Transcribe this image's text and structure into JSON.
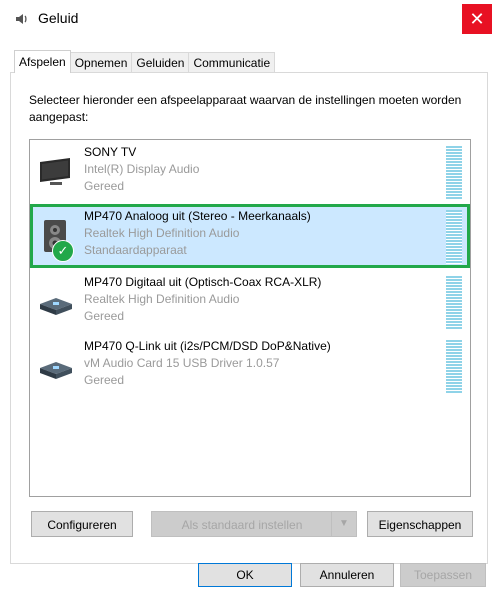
{
  "window": {
    "title": "Geluid",
    "close_glyph": "✕"
  },
  "tabs": [
    {
      "label": "Afspelen",
      "active": true
    },
    {
      "label": "Opnemen",
      "active": false
    },
    {
      "label": "Geluiden",
      "active": false
    },
    {
      "label": "Communicatie",
      "active": false
    }
  ],
  "instructions": "Selecteer hieronder een afspeelapparaat waarvan de instellingen moeten worden aangepast:",
  "devices": [
    {
      "name": "SONY TV",
      "driver": "Intel(R) Display Audio",
      "status": "Gereed",
      "icon": "tv-icon",
      "selected": false,
      "default": false
    },
    {
      "name": "MP470 Analoog uit (Stereo - Meerkanaals)",
      "driver": "Realtek High Definition Audio",
      "status": "Standaardapparaat",
      "icon": "speaker-icon",
      "selected": true,
      "default": true
    },
    {
      "name": "MP470 Digitaal uit (Optisch-Coax RCA-XLR)",
      "driver": "Realtek High Definition Audio",
      "status": "Gereed",
      "icon": "digital-output-icon",
      "selected": false,
      "default": false
    },
    {
      "name": "MP470 Q-Link uit (i2s/PCM/DSD DoP&Native)",
      "driver": "vM Audio Card 15 USB Driver 1.0.57",
      "status": "Gereed",
      "icon": "digital-output-icon",
      "selected": false,
      "default": false
    }
  ],
  "buttons": {
    "configure": "Configureren",
    "set_default": "Als standaard instellen",
    "properties": "Eigenschappen",
    "ok": "OK",
    "cancel": "Annuleren",
    "apply": "Toepassen"
  },
  "colors": {
    "selected_bg": "#cce8ff",
    "highlight_border": "#22a84a",
    "close_red": "#e81123"
  }
}
